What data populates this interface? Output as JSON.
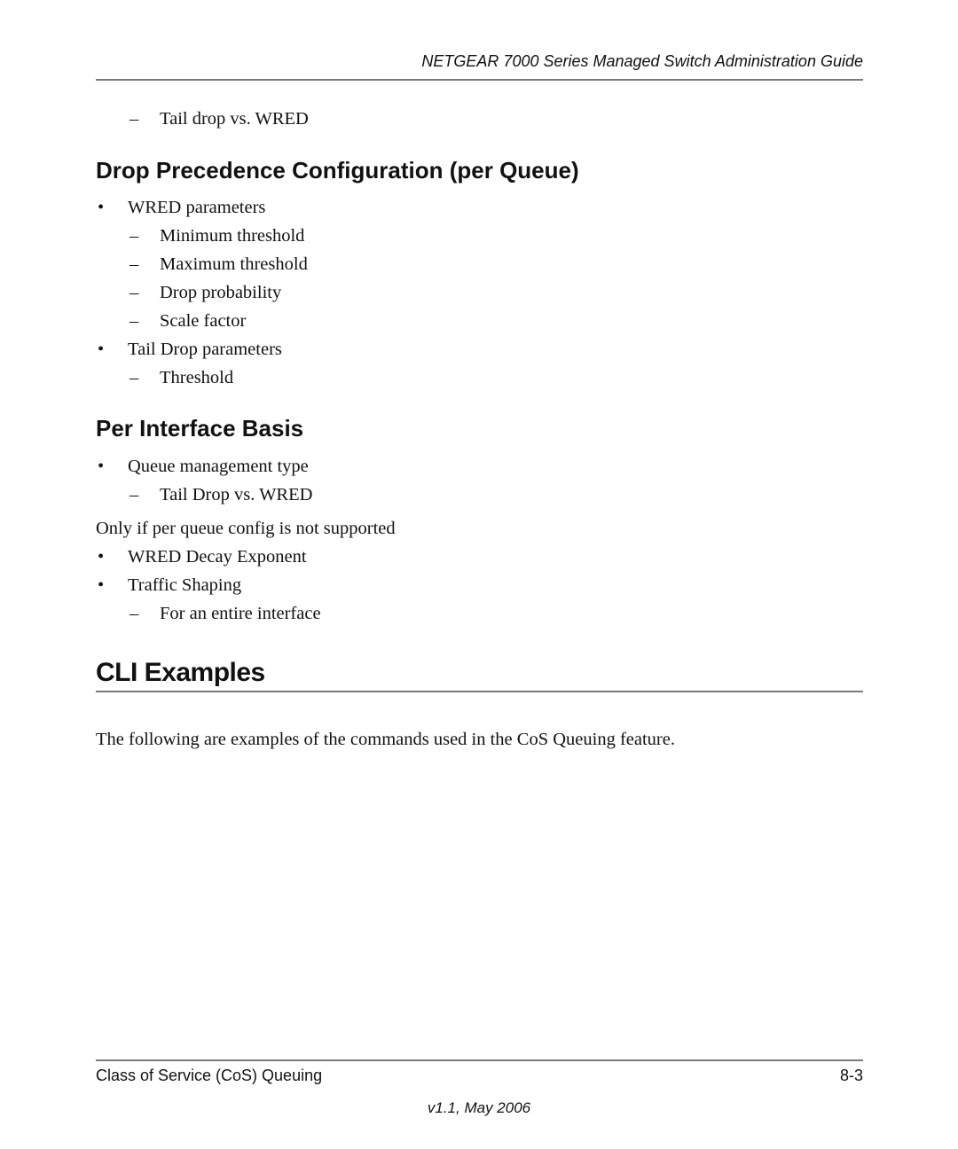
{
  "header": {
    "title": "NETGEAR 7000  Series Managed Switch Administration Guide"
  },
  "intro_item": {
    "marker": "–",
    "text": "Tail drop vs. WRED"
  },
  "drop_precedence": {
    "heading": "Drop Precedence Configuration (per Queue)",
    "items": [
      {
        "marker": "•",
        "level": 1,
        "text": "WRED parameters"
      },
      {
        "marker": "–",
        "level": 2,
        "text": "Minimum threshold"
      },
      {
        "marker": "–",
        "level": 2,
        "text": "Maximum threshold"
      },
      {
        "marker": "–",
        "level": 2,
        "text": "Drop probability"
      },
      {
        "marker": "–",
        "level": 2,
        "text": "Scale factor"
      },
      {
        "marker": "•",
        "level": 1,
        "text": "Tail Drop parameters"
      },
      {
        "marker": "–",
        "level": 2,
        "text": "Threshold"
      }
    ]
  },
  "per_interface": {
    "heading": "Per Interface Basis",
    "items": [
      {
        "marker": "•",
        "level": 1,
        "text": "Queue management type"
      },
      {
        "marker": "–",
        "level": 2,
        "text": "Tail Drop vs. WRED"
      },
      {
        "marker": "",
        "level": 0,
        "text": "Only if per queue config is not supported"
      },
      {
        "marker": "•",
        "level": 1,
        "text": "WRED Decay Exponent"
      },
      {
        "marker": "•",
        "level": 1,
        "text": "Traffic Shaping"
      },
      {
        "marker": "–",
        "level": 2,
        "text": "For an entire interface"
      }
    ]
  },
  "cli_examples": {
    "heading": "CLI Examples",
    "paragraph": "The following are examples of the commands used in the CoS Queuing feature."
  },
  "footer": {
    "chapter": "Class of Service (CoS) Queuing",
    "page_number": "8-3",
    "version": "v1.1, May 2006"
  }
}
